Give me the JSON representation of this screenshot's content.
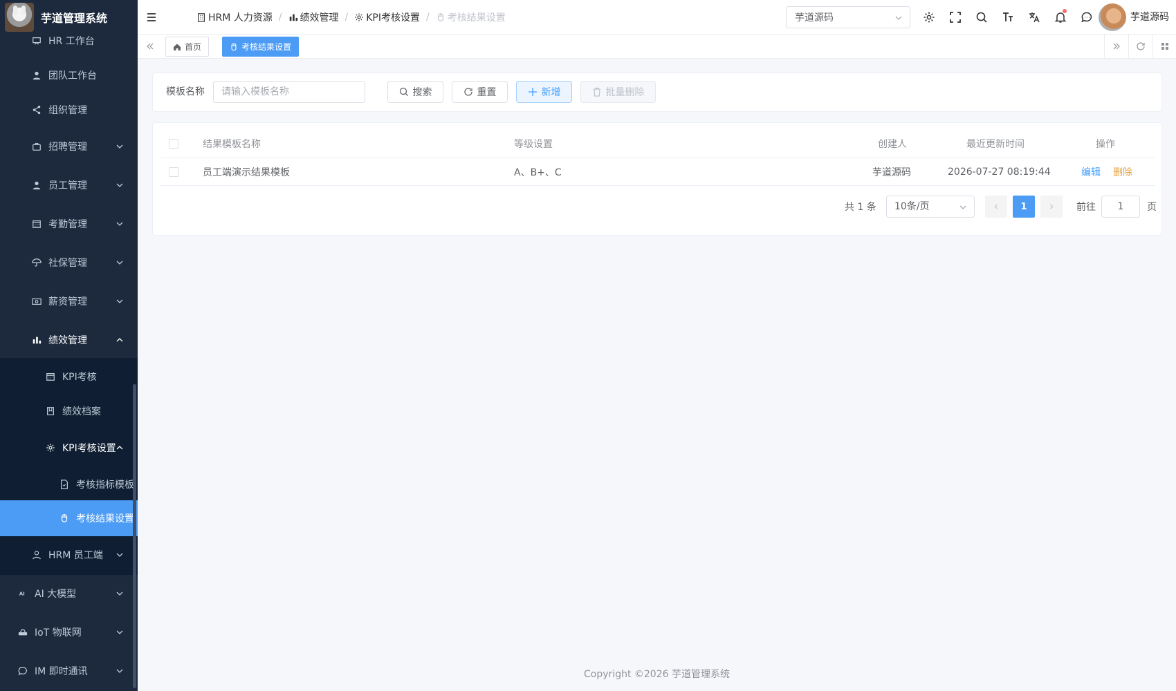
{
  "app": {
    "title": "芋道管理系统"
  },
  "sidebar": {
    "items": [
      {
        "label": "HR 工作台",
        "icon": "presentation-icon"
      },
      {
        "label": "团队工作台",
        "icon": "user-icon"
      },
      {
        "label": "组织管理",
        "icon": "share-icon"
      },
      {
        "label": "招聘管理",
        "icon": "briefcase-icon"
      },
      {
        "label": "员工管理",
        "icon": "user-icon"
      },
      {
        "label": "考勤管理",
        "icon": "calendar-icon"
      },
      {
        "label": "社保管理",
        "icon": "umbrella-icon"
      },
      {
        "label": "薪资管理",
        "icon": "money-icon"
      },
      {
        "label": "绩效管理",
        "icon": "bar-chart-icon"
      },
      {
        "label": "KPI考核",
        "icon": "calendar-icon"
      },
      {
        "label": "绩效档案",
        "icon": "notebook-icon"
      },
      {
        "label": "KPI考核设置",
        "icon": "gear-icon"
      },
      {
        "label": "考核指标模板",
        "icon": "document-icon"
      },
      {
        "label": "考核结果设置",
        "icon": "mouse-icon"
      },
      {
        "label": "HRM 员工端",
        "icon": "user-outline-icon"
      },
      {
        "label": "AI 大模型",
        "icon": "ai-icon"
      },
      {
        "label": "IoT 物联网",
        "icon": "router-icon"
      },
      {
        "label": "IM 即时通讯",
        "icon": "chat-icon"
      }
    ]
  },
  "header": {
    "breadcrumb": [
      {
        "label": "HRM 人力资源",
        "icon": "building-icon"
      },
      {
        "label": "绩效管理",
        "icon": "bar-chart-icon"
      },
      {
        "label": "KPI考核设置",
        "icon": "gear-icon"
      },
      {
        "label": "考核结果设置",
        "icon": "mouse-icon"
      }
    ],
    "tenant": "芋道源码",
    "username": "芋道源码"
  },
  "tags": {
    "home": "首页",
    "current": "考核结果设置"
  },
  "search": {
    "label": "模板名称",
    "placeholder": "请输入模板名称",
    "search_btn": "搜索",
    "reset_btn": "重置",
    "add_btn": "新增",
    "batch_delete_btn": "批量删除"
  },
  "table": {
    "columns": [
      "结果模板名称",
      "等级设置",
      "创建人",
      "最近更新时间",
      "操作"
    ],
    "rows": [
      {
        "name": "员工端演示结果模板",
        "levels": "A、B+、C",
        "creator": "芋道源码",
        "updated": "2026-07-27 08:19:44",
        "edit": "编辑",
        "delete": "删除"
      }
    ]
  },
  "pagination": {
    "total": "共 1 条",
    "page_size": "10条/页",
    "current_page": "1",
    "goto_label": "前往",
    "goto_value": "1",
    "page_unit": "页"
  },
  "footer": "Copyright ©2026 芋道管理系统",
  "colors": {
    "sidebar_bg": "#1d2a3e",
    "submenu_bg": "#0f1e33",
    "accent": "#4c9cf5",
    "danger_link": "#e6a23c"
  }
}
